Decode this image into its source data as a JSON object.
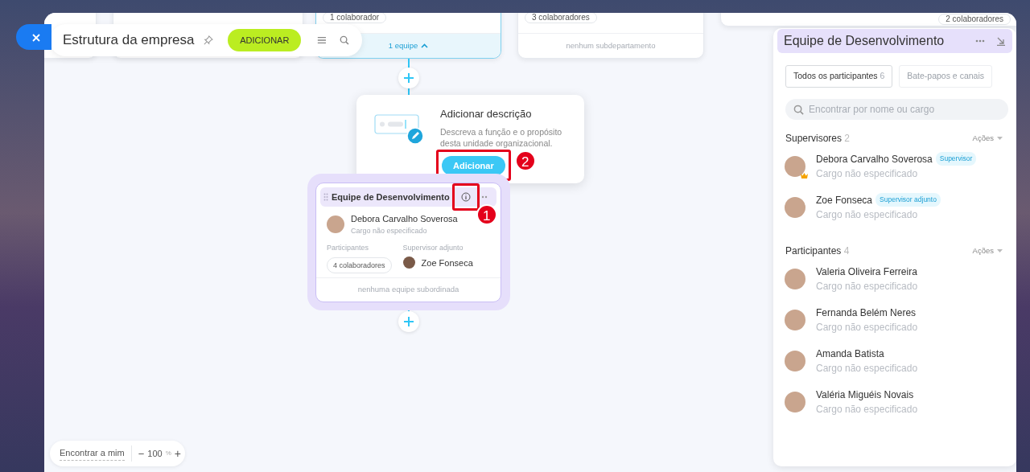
{
  "toolbar": {
    "title": "Estrutura da empresa",
    "add_button": "ADICIONAR"
  },
  "canvas": {
    "top_cards": [
      {
        "tag": "1 colaborador",
        "footer": "1 equipe",
        "selected": true,
        "expanded": true
      },
      {
        "tag": "3 colaboradores",
        "footer": "nenhum subdepartamento",
        "selected": false,
        "expanded": false
      },
      {
        "tag": "2 colaboradores",
        "selected": false
      }
    ],
    "popover": {
      "title": "Adicionar descrição",
      "description": "Descreva a função e o propósito desta unidade organizacional.",
      "button": "Adicionar"
    },
    "team_card": {
      "title": "Equipe de Desenvolvimento",
      "head_name": "Debora Carvalho Soverosa",
      "head_position": "Cargo não especificado",
      "participants_label": "Participantes",
      "participants_count": "4 colaboradores",
      "deputy_label": "Supervisor adjunto",
      "deputy_name": "Zoe Fonseca",
      "footer": "nenhuma equipe subordinada"
    },
    "annotations": [
      {
        "number": "1"
      },
      {
        "number": "2"
      }
    ]
  },
  "zoom_bar": {
    "find_me": "Encontrar a mim",
    "minus": "−",
    "value": "100",
    "unit": "%",
    "plus": "+"
  },
  "side_panel": {
    "title": "Equipe de Desenvolvimento",
    "tabs": [
      {
        "label": "Todos os participantes",
        "count": "6",
        "selected": true
      },
      {
        "label": "Bate-papos e canais",
        "selected": false
      }
    ],
    "search": {
      "placeholder": "Encontrar por nome ou cargo"
    },
    "sections": [
      {
        "title": "Supervisores",
        "count": "2",
        "actions": "Ações",
        "members": [
          {
            "name": "Debora Carvalho Soverosa",
            "badge": "Supervisor",
            "position": "Cargo não especificado",
            "crown": true
          },
          {
            "name": "Zoe Fonseca",
            "badge": "Supervisor adjunto",
            "position": "Cargo não especificado",
            "crown": false
          }
        ]
      },
      {
        "title": "Participantes",
        "count": "4",
        "actions": "Ações",
        "members": [
          {
            "name": "Valeria Oliveira Ferreira",
            "position": "Cargo não especificado",
            "crown": false
          },
          {
            "name": "Fernanda Belém Neres",
            "position": "Cargo não especificado",
            "crown": false
          },
          {
            "name": "Amanda Batista",
            "position": "Cargo não especificado",
            "crown": false
          },
          {
            "name": "Valéria Miguéis Novais",
            "position": "Cargo não especificado",
            "crown": false
          }
        ]
      }
    ]
  }
}
